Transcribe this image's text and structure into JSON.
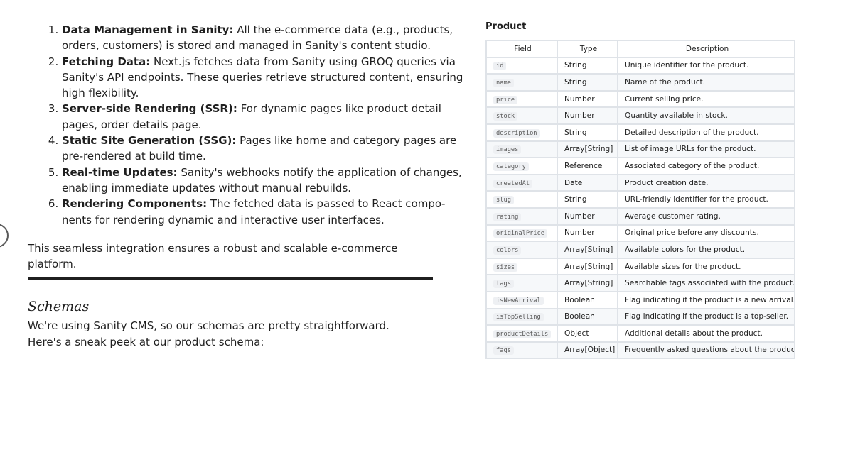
{
  "steps": [
    {
      "term": "Data Management in Sanity:",
      "text": "All the e-commerce data (e.g., products, orders, customers) is stored and managed in Sanity's content studio."
    },
    {
      "term": "Fetching Data:",
      "text": "Next.js fetches data from Sanity using GROQ queries via Sanity's API endpoints. These queries retrieve structured content, ensur­ing high flexibility."
    },
    {
      "term": "Server-side Rendering (SSR):",
      "text": "For dynamic pages like product detail pages, order details page."
    },
    {
      "term": "Static Site Generation (SSG):",
      "text": "Pages like home and category pages are pre-rendered at build time."
    },
    {
      "term": "Real-time Updates:",
      "text": "Sanity's webhooks notify the application of changes, enabling immediate updates without manual rebuilds."
    },
    {
      "term": "Rendering Components:",
      "text": "The fetched data is passed to React compo­nents for rendering dynamic and interactive user interfaces."
    }
  ],
  "summary": "This seamless integration ensures a robust and scalable e-commerce platform.",
  "section": {
    "heading": "Schemas",
    "intro": "We're using Sanity CMS, so our schemas are pretty straightforward. Here's a sneak peek at our product schema:"
  },
  "table": {
    "title": "Product",
    "headers": {
      "field": "Field",
      "type": "Type",
      "description": "Description"
    },
    "rows": [
      {
        "field": "id",
        "type": "String",
        "description": "Unique identifier for the product."
      },
      {
        "field": "name",
        "type": "String",
        "description": "Name of the product."
      },
      {
        "field": "price",
        "type": "Number",
        "description": "Current selling price."
      },
      {
        "field": "stock",
        "type": "Number",
        "description": "Quantity available in stock."
      },
      {
        "field": "description",
        "type": "String",
        "description": "Detailed description of the product."
      },
      {
        "field": "images",
        "type": "Array[String]",
        "description": "List of image URLs for the product."
      },
      {
        "field": "category",
        "type": "Reference",
        "description": "Associated category of the product."
      },
      {
        "field": "createdAt",
        "type": "Date",
        "description": "Product creation date."
      },
      {
        "field": "slug",
        "type": "String",
        "description": "URL-friendly identifier for the product."
      },
      {
        "field": "rating",
        "type": "Number",
        "description": "Average customer rating."
      },
      {
        "field": "originalPrice",
        "type": "Number",
        "description": "Original price before any discounts."
      },
      {
        "field": "colors",
        "type": "Array[String]",
        "description": "Available colors for the product."
      },
      {
        "field": "sizes",
        "type": "Array[String]",
        "description": "Available sizes for the product."
      },
      {
        "field": "tags",
        "type": "Array[String]",
        "description": "Searchable tags associated with the product."
      },
      {
        "field": "isNewArrival",
        "type": "Boolean",
        "description": "Flag indicating if the product is a new arrival."
      },
      {
        "field": "isTopSelling",
        "type": "Boolean",
        "description": "Flag indicating if the product is a top-seller."
      },
      {
        "field": "productDetails",
        "type": "Object",
        "description": "Additional details about the product."
      },
      {
        "field": "faqs",
        "type": "Array[Object]",
        "description": "Frequently asked questions about the product."
      }
    ]
  }
}
